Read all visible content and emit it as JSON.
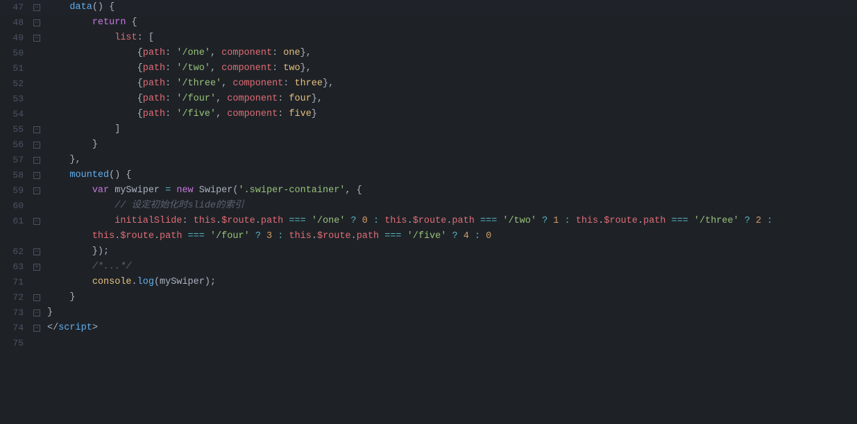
{
  "editor": {
    "bg": "#1e2227",
    "lines": [
      {
        "num": "47",
        "fold": "hollow",
        "content": [
          {
            "t": "    ",
            "c": "plain"
          },
          {
            "t": "data",
            "c": "kw-data"
          },
          {
            "t": "() {",
            "c": "plain"
          }
        ]
      },
      {
        "num": "48",
        "fold": "hollow",
        "content": [
          {
            "t": "        ",
            "c": "plain"
          },
          {
            "t": "return",
            "c": "kw-return"
          },
          {
            "t": " {",
            "c": "plain"
          }
        ]
      },
      {
        "num": "49",
        "fold": "hollow",
        "content": [
          {
            "t": "            ",
            "c": "plain"
          },
          {
            "t": "list",
            "c": "key"
          },
          {
            "t": ": [",
            "c": "plain"
          }
        ]
      },
      {
        "num": "50",
        "fold": "",
        "content": [
          {
            "t": "                ",
            "c": "plain"
          },
          {
            "t": "{",
            "c": "plain"
          },
          {
            "t": "path",
            "c": "key"
          },
          {
            "t": ": ",
            "c": "plain"
          },
          {
            "t": "'/one'",
            "c": "str"
          },
          {
            "t": ", ",
            "c": "plain"
          },
          {
            "t": "component",
            "c": "key"
          },
          {
            "t": ": ",
            "c": "plain"
          },
          {
            "t": "one",
            "c": "val-name"
          },
          {
            "t": "},",
            "c": "plain"
          }
        ]
      },
      {
        "num": "51",
        "fold": "",
        "content": [
          {
            "t": "                ",
            "c": "plain"
          },
          {
            "t": "{",
            "c": "plain"
          },
          {
            "t": "path",
            "c": "key"
          },
          {
            "t": ": ",
            "c": "plain"
          },
          {
            "t": "'/two'",
            "c": "str"
          },
          {
            "t": ", ",
            "c": "plain"
          },
          {
            "t": "component",
            "c": "key"
          },
          {
            "t": ": ",
            "c": "plain"
          },
          {
            "t": "two",
            "c": "val-name"
          },
          {
            "t": "},",
            "c": "plain"
          }
        ]
      },
      {
        "num": "52",
        "fold": "",
        "content": [
          {
            "t": "                ",
            "c": "plain"
          },
          {
            "t": "{",
            "c": "plain"
          },
          {
            "t": "path",
            "c": "key"
          },
          {
            "t": ": ",
            "c": "plain"
          },
          {
            "t": "'/three'",
            "c": "str"
          },
          {
            "t": ", ",
            "c": "plain"
          },
          {
            "t": "component",
            "c": "key"
          },
          {
            "t": ": ",
            "c": "plain"
          },
          {
            "t": "three",
            "c": "val-name"
          },
          {
            "t": "},",
            "c": "plain"
          }
        ]
      },
      {
        "num": "53",
        "fold": "",
        "content": [
          {
            "t": "                ",
            "c": "plain"
          },
          {
            "t": "{",
            "c": "plain"
          },
          {
            "t": "path",
            "c": "key"
          },
          {
            "t": ": ",
            "c": "plain"
          },
          {
            "t": "'/four'",
            "c": "str"
          },
          {
            "t": ", ",
            "c": "plain"
          },
          {
            "t": "component",
            "c": "key"
          },
          {
            "t": ": ",
            "c": "plain"
          },
          {
            "t": "four",
            "c": "val-name"
          },
          {
            "t": "},",
            "c": "plain"
          }
        ]
      },
      {
        "num": "54",
        "fold": "",
        "content": [
          {
            "t": "                ",
            "c": "plain"
          },
          {
            "t": "{",
            "c": "plain"
          },
          {
            "t": "path",
            "c": "key"
          },
          {
            "t": ": ",
            "c": "plain"
          },
          {
            "t": "'/five'",
            "c": "str"
          },
          {
            "t": ", ",
            "c": "plain"
          },
          {
            "t": "component",
            "c": "key"
          },
          {
            "t": ": ",
            "c": "plain"
          },
          {
            "t": "five",
            "c": "val-name"
          },
          {
            "t": "}",
            "c": "plain"
          }
        ]
      },
      {
        "num": "55",
        "fold": "hollow",
        "content": [
          {
            "t": "            ]",
            "c": "plain"
          }
        ]
      },
      {
        "num": "56",
        "fold": "hollow",
        "content": [
          {
            "t": "        }",
            "c": "plain"
          }
        ]
      },
      {
        "num": "57",
        "fold": "hollow",
        "content": [
          {
            "t": "    },",
            "c": "plain"
          }
        ]
      },
      {
        "num": "58",
        "fold": "hollow",
        "content": [
          {
            "t": "    ",
            "c": "plain"
          },
          {
            "t": "mounted",
            "c": "fn-name"
          },
          {
            "t": "() {",
            "c": "plain"
          }
        ]
      },
      {
        "num": "59",
        "fold": "hollow",
        "content": [
          {
            "t": "        ",
            "c": "plain"
          },
          {
            "t": "var",
            "c": "kw-var"
          },
          {
            "t": " mySwiper ",
            "c": "plain"
          },
          {
            "t": "=",
            "c": "op"
          },
          {
            "t": " ",
            "c": "plain"
          },
          {
            "t": "new",
            "c": "kw-new"
          },
          {
            "t": " Swiper(",
            "c": "plain"
          },
          {
            "t": "'.swiper-container'",
            "c": "str"
          },
          {
            "t": ", {",
            "c": "plain"
          }
        ]
      },
      {
        "num": "60",
        "fold": "",
        "content": [
          {
            "t": "            ",
            "c": "plain"
          },
          {
            "t": "// 设定初始化时slide的索引",
            "c": "comment"
          }
        ]
      },
      {
        "num": "61",
        "fold": "hollow",
        "content": [
          {
            "t": "            ",
            "c": "plain"
          },
          {
            "t": "initialSlide",
            "c": "key"
          },
          {
            "t": ": ",
            "c": "plain"
          },
          {
            "t": "this",
            "c": "kw-this"
          },
          {
            "t": ".",
            "c": "plain"
          },
          {
            "t": "$route",
            "c": "prop"
          },
          {
            "t": ".",
            "c": "plain"
          },
          {
            "t": "path",
            "c": "prop"
          },
          {
            "t": " ",
            "c": "plain"
          },
          {
            "t": "===",
            "c": "op"
          },
          {
            "t": " ",
            "c": "plain"
          },
          {
            "t": "'/one'",
            "c": "str"
          },
          {
            "t": " ",
            "c": "plain"
          },
          {
            "t": "?",
            "c": "ternary"
          },
          {
            "t": " ",
            "c": "plain"
          },
          {
            "t": "0",
            "c": "num"
          },
          {
            "t": " ",
            "c": "plain"
          },
          {
            "t": ":",
            "c": "ternary"
          },
          {
            "t": " ",
            "c": "plain"
          },
          {
            "t": "this",
            "c": "kw-this"
          },
          {
            "t": ".",
            "c": "plain"
          },
          {
            "t": "$route",
            "c": "prop"
          },
          {
            "t": ".",
            "c": "plain"
          },
          {
            "t": "path",
            "c": "prop"
          },
          {
            "t": " ",
            "c": "plain"
          },
          {
            "t": "===",
            "c": "op"
          },
          {
            "t": " ",
            "c": "plain"
          },
          {
            "t": "'/two'",
            "c": "str"
          },
          {
            "t": " ",
            "c": "plain"
          },
          {
            "t": "?",
            "c": "ternary"
          },
          {
            "t": " ",
            "c": "plain"
          },
          {
            "t": "1",
            "c": "num"
          },
          {
            "t": " ",
            "c": "plain"
          },
          {
            "t": ":",
            "c": "ternary"
          },
          {
            "t": " ",
            "c": "plain"
          },
          {
            "t": "this",
            "c": "kw-this"
          },
          {
            "t": ".",
            "c": "plain"
          },
          {
            "t": "$route",
            "c": "prop"
          },
          {
            "t": ".",
            "c": "plain"
          },
          {
            "t": "path",
            "c": "prop"
          },
          {
            "t": " ",
            "c": "plain"
          },
          {
            "t": "===",
            "c": "op"
          },
          {
            "t": " ",
            "c": "plain"
          },
          {
            "t": "'/three'",
            "c": "str"
          },
          {
            "t": " ",
            "c": "plain"
          },
          {
            "t": "?",
            "c": "ternary"
          },
          {
            "t": " ",
            "c": "plain"
          },
          {
            "t": "2",
            "c": "num"
          },
          {
            "t": " :",
            "c": "ternary"
          }
        ]
      },
      {
        "num": "",
        "fold": "",
        "content": [
          {
            "t": "        ",
            "c": "plain"
          },
          {
            "t": "this",
            "c": "kw-this"
          },
          {
            "t": ".",
            "c": "plain"
          },
          {
            "t": "$route",
            "c": "prop"
          },
          {
            "t": ".",
            "c": "plain"
          },
          {
            "t": "path",
            "c": "prop"
          },
          {
            "t": " ",
            "c": "plain"
          },
          {
            "t": "===",
            "c": "op"
          },
          {
            "t": " ",
            "c": "plain"
          },
          {
            "t": "'/four'",
            "c": "str"
          },
          {
            "t": " ",
            "c": "plain"
          },
          {
            "t": "?",
            "c": "ternary"
          },
          {
            "t": " ",
            "c": "plain"
          },
          {
            "t": "3",
            "c": "num"
          },
          {
            "t": " ",
            "c": "plain"
          },
          {
            "t": ":",
            "c": "ternary"
          },
          {
            "t": " ",
            "c": "plain"
          },
          {
            "t": "this",
            "c": "kw-this"
          },
          {
            "t": ".",
            "c": "plain"
          },
          {
            "t": "$route",
            "c": "prop"
          },
          {
            "t": ".",
            "c": "plain"
          },
          {
            "t": "path",
            "c": "prop"
          },
          {
            "t": " ",
            "c": "plain"
          },
          {
            "t": "===",
            "c": "op"
          },
          {
            "t": " ",
            "c": "plain"
          },
          {
            "t": "'/five'",
            "c": "str"
          },
          {
            "t": " ",
            "c": "plain"
          },
          {
            "t": "?",
            "c": "ternary"
          },
          {
            "t": " ",
            "c": "plain"
          },
          {
            "t": "4",
            "c": "num"
          },
          {
            "t": " ",
            "c": "plain"
          },
          {
            "t": ":",
            "c": "ternary"
          },
          {
            "t": " ",
            "c": "plain"
          },
          {
            "t": "0",
            "c": "num"
          }
        ]
      },
      {
        "num": "62",
        "fold": "hollow",
        "content": [
          {
            "t": "        });",
            "c": "plain"
          }
        ]
      },
      {
        "num": "63",
        "fold": "plus",
        "content": [
          {
            "t": "        ",
            "c": "plain"
          },
          {
            "t": "/*...*/",
            "c": "comment"
          }
        ]
      },
      {
        "num": "71",
        "fold": "",
        "content": [
          {
            "t": "        ",
            "c": "plain"
          },
          {
            "t": "console",
            "c": "val-name"
          },
          {
            "t": ".",
            "c": "plain"
          },
          {
            "t": "log",
            "c": "fn-name"
          },
          {
            "t": "(mySwiper)",
            "c": "plain"
          },
          {
            "t": ";",
            "c": "plain"
          }
        ]
      },
      {
        "num": "72",
        "fold": "hollow",
        "content": [
          {
            "t": "    }",
            "c": "plain"
          }
        ]
      },
      {
        "num": "73",
        "fold": "hollow",
        "content": [
          {
            "t": "}",
            "c": "plain"
          }
        ]
      },
      {
        "num": "74",
        "fold": "hollow",
        "content": [
          {
            "t": "</",
            "c": "plain"
          },
          {
            "t": "script",
            "c": "fn-name"
          },
          {
            "t": ">",
            "c": "plain"
          }
        ]
      },
      {
        "num": "75",
        "fold": "",
        "content": []
      }
    ]
  }
}
